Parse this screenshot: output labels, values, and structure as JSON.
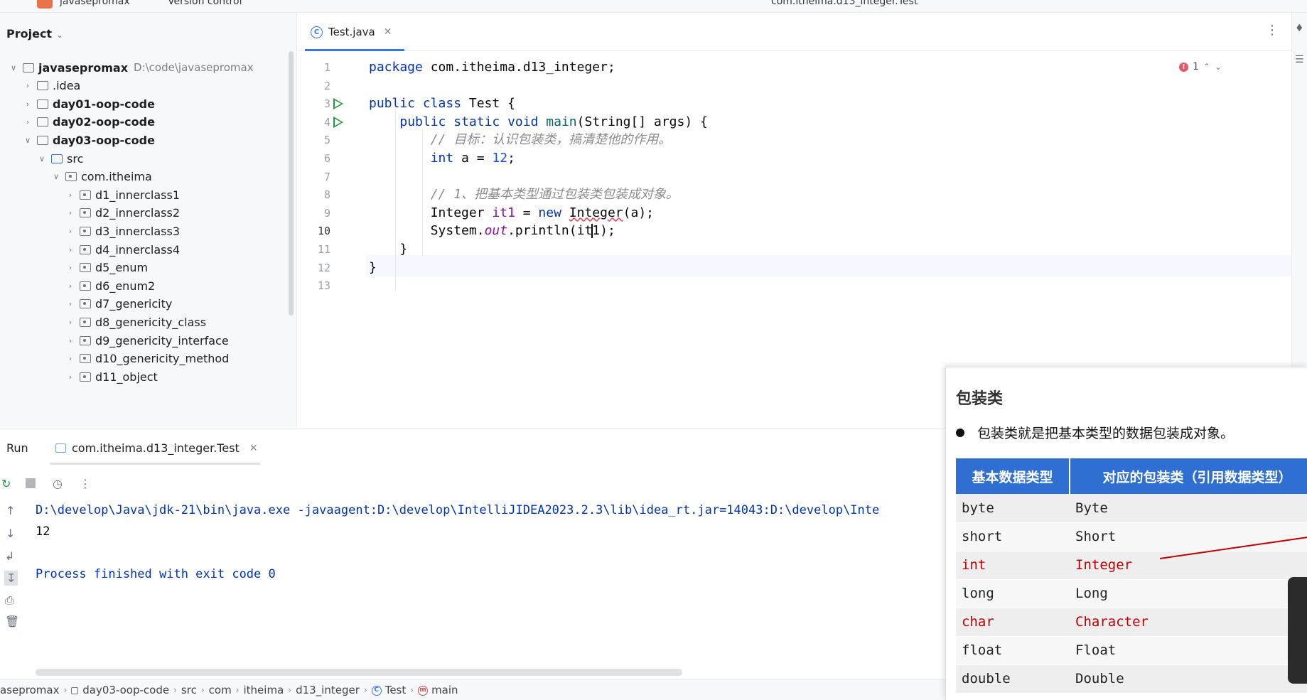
{
  "topbar": {
    "project_name": "javasepromax",
    "vcs": "Version control",
    "run_config": "com.itheima.d13_integer.Test"
  },
  "project_panel": {
    "title": "Project",
    "tree": [
      {
        "label": "javasepromax",
        "path": "D:\\code\\javasepromax",
        "level": 0,
        "expanded": true,
        "bold": true,
        "icon": "module-folder-icon"
      },
      {
        "label": ".idea",
        "level": 1,
        "expanded": false,
        "bold": false,
        "icon": "folder-icon"
      },
      {
        "label": "day01-oop-code",
        "level": 1,
        "expanded": false,
        "bold": true,
        "icon": "module-folder-icon"
      },
      {
        "label": "day02-oop-code",
        "level": 1,
        "expanded": false,
        "bold": true,
        "icon": "module-folder-icon"
      },
      {
        "label": "day03-oop-code",
        "level": 1,
        "expanded": true,
        "bold": true,
        "icon": "module-folder-icon"
      },
      {
        "label": "src",
        "level": 2,
        "expanded": true,
        "bold": false,
        "icon": "source-folder-icon"
      },
      {
        "label": "com.itheima",
        "level": 3,
        "expanded": true,
        "bold": false,
        "icon": "package-icon"
      },
      {
        "label": "d1_innerclass1",
        "level": 4,
        "expanded": false,
        "bold": false,
        "icon": "package-icon"
      },
      {
        "label": "d2_innerclass2",
        "level": 4,
        "expanded": false,
        "bold": false,
        "icon": "package-icon"
      },
      {
        "label": "d3_innerclass3",
        "level": 4,
        "expanded": false,
        "bold": false,
        "icon": "package-icon"
      },
      {
        "label": "d4_innerclass4",
        "level": 4,
        "expanded": false,
        "bold": false,
        "icon": "package-icon"
      },
      {
        "label": "d5_enum",
        "level": 4,
        "expanded": false,
        "bold": false,
        "icon": "package-icon"
      },
      {
        "label": "d6_enum2",
        "level": 4,
        "expanded": false,
        "bold": false,
        "icon": "package-icon"
      },
      {
        "label": "d7_genericity",
        "level": 4,
        "expanded": false,
        "bold": false,
        "icon": "package-icon"
      },
      {
        "label": "d8_genericity_class",
        "level": 4,
        "expanded": false,
        "bold": false,
        "icon": "package-icon"
      },
      {
        "label": "d9_genericity_interface",
        "level": 4,
        "expanded": false,
        "bold": false,
        "icon": "package-icon"
      },
      {
        "label": "d10_genericity_method",
        "level": 4,
        "expanded": false,
        "bold": false,
        "icon": "package-icon"
      },
      {
        "label": "d11_object",
        "level": 4,
        "expanded": false,
        "bold": false,
        "icon": "package-icon"
      }
    ]
  },
  "editor": {
    "tab_label": "Test.java",
    "error_count": "1",
    "lines": [
      {
        "n": "1",
        "run": false,
        "html": "<span class='kw'>package</span> com.itheima.d13_integer;"
      },
      {
        "n": "2",
        "run": false,
        "html": ""
      },
      {
        "n": "3",
        "run": true,
        "html": "<span class='kw'>public class</span> Test {"
      },
      {
        "n": "4",
        "run": true,
        "html": "    <span class='kw'>public static void</span> <span style='color:#00627a'>main</span>(String[] args) {"
      },
      {
        "n": "5",
        "run": false,
        "html": "        <span class='cmt'>// 目标：认识包装类，搞清楚他的作用。</span>"
      },
      {
        "n": "6",
        "run": false,
        "html": "        <span class='kw'>int</span> a = <span class='num'>12</span>;"
      },
      {
        "n": "7",
        "run": false,
        "html": ""
      },
      {
        "n": "8",
        "run": false,
        "html": "        <span class='cmt'>// 1、把基本类型通过包装类包装成对象。</span>"
      },
      {
        "n": "9",
        "run": false,
        "html": "        Integer <span class='err'>it1</span> = <span class='kw'>new</span> <span class='squig'>Integer</span>(a);"
      },
      {
        "n": "10",
        "run": false,
        "html": "        System.<span class='ital'>out</span>.println(it<span class='cursor-mark'></span>1);"
      },
      {
        "n": "11",
        "run": false,
        "html": "    }"
      },
      {
        "n": "12",
        "run": false,
        "html": "}"
      },
      {
        "n": "13",
        "run": false,
        "html": ""
      }
    ]
  },
  "run_panel": {
    "title": "Run",
    "tab_label": "com.itheima.d13_integer.Test",
    "console": [
      {
        "text": "D:\\develop\\Java\\jdk-21\\bin\\java.exe -javaagent:D:\\develop\\IntelliJIDEA2023.2.3\\lib\\idea_rt.jar=14043:D:\\develop\\Inte",
        "kind": "cmd"
      },
      {
        "text": "12",
        "kind": "out"
      },
      {
        "text": "",
        "kind": "out"
      },
      {
        "text": "Process finished with exit code 0",
        "kind": "cmd"
      }
    ]
  },
  "statusbar": {
    "crumbs": [
      {
        "label": "asepromax",
        "icon": ""
      },
      {
        "label": "day03-oop-code",
        "icon": "module"
      },
      {
        "label": "src",
        "icon": ""
      },
      {
        "label": "com",
        "icon": ""
      },
      {
        "label": "itheima",
        "icon": ""
      },
      {
        "label": "d13_integer",
        "icon": ""
      },
      {
        "label": "Test",
        "icon": "class"
      },
      {
        "label": "main",
        "icon": "method"
      }
    ]
  },
  "slide": {
    "title": "包装类",
    "bullet": "包装类就是把基本类型的数据包装成对象。",
    "table_headers": [
      "基本数据类型",
      "对应的包装类（引用数据类型）"
    ],
    "rows": [
      {
        "primitive": "byte",
        "wrapper": "Byte",
        "highlight": false
      },
      {
        "primitive": "short",
        "wrapper": "Short",
        "highlight": false
      },
      {
        "primitive": "int",
        "wrapper": "Integer",
        "highlight": true
      },
      {
        "primitive": "long",
        "wrapper": "Long",
        "highlight": false
      },
      {
        "primitive": "char",
        "wrapper": "Character",
        "highlight": true
      },
      {
        "primitive": "float",
        "wrapper": "Float",
        "highlight": false
      },
      {
        "primitive": "double",
        "wrapper": "Double",
        "highlight": false
      }
    ]
  },
  "colors": {
    "accent": "#3574f0",
    "keyword": "#0033b3",
    "error": "#e55765",
    "slide_header": "#2f6fd1",
    "slide_highlight": "#c00000"
  }
}
